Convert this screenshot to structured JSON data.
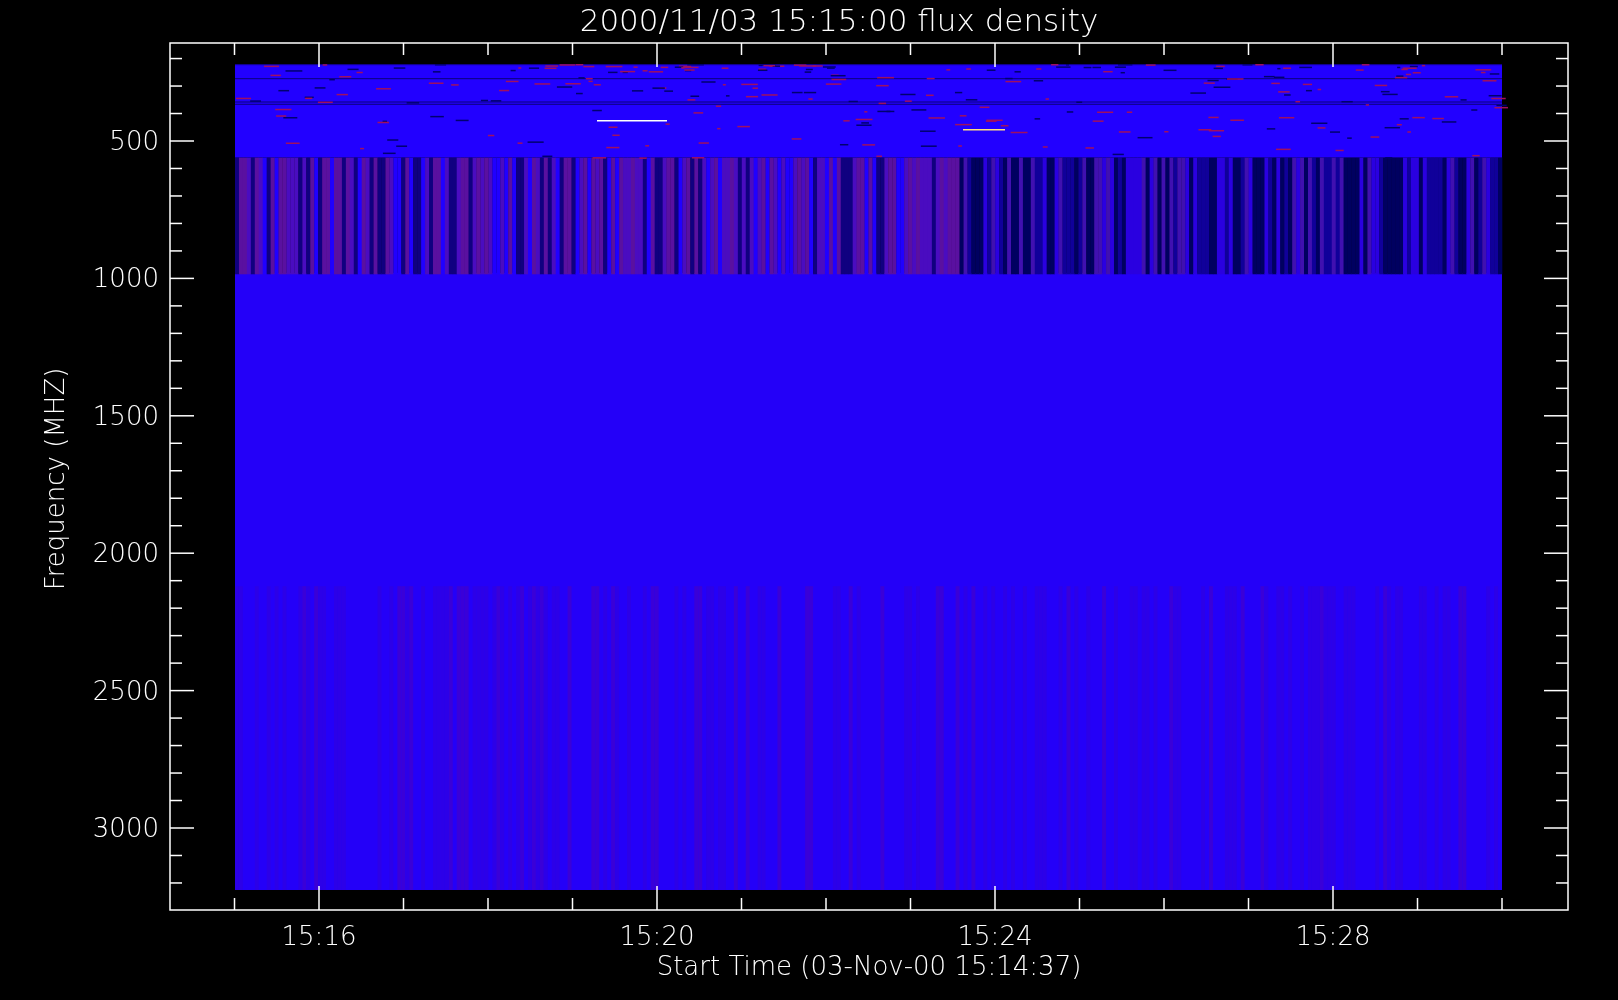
{
  "title": "2000/11/03 15:15:00 flux density",
  "y_axis": {
    "label": "Frequency (MHZ)",
    "ticks": [
      "500",
      "1000",
      "1500",
      "2000",
      "2500",
      "3000"
    ]
  },
  "x_axis": {
    "label": "Start Time (03-Nov-00 15:14:37)",
    "ticks": [
      "15:16",
      "15:20",
      "15:24",
      "15:28"
    ]
  }
}
